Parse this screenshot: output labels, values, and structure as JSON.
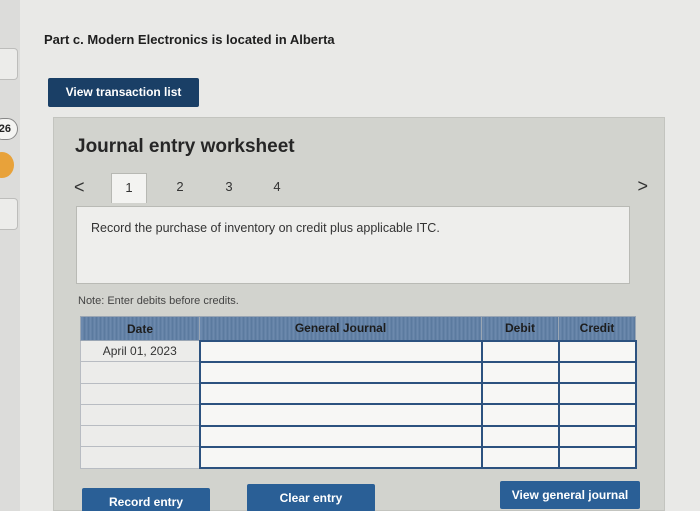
{
  "sidebar": {
    "question_number": "26"
  },
  "part_title": "Part c. Modern Electronics is located in Alberta",
  "view_transaction_button": "View transaction list",
  "worksheet": {
    "title": "Journal entry worksheet",
    "tabs": {
      "prev": "<",
      "items": [
        "1",
        "2",
        "3",
        "4"
      ],
      "active": "1",
      "next": ">"
    },
    "instruction": "Record the purchase of inventory on credit plus applicable ITC.",
    "note": "Note: Enter debits before credits.",
    "table": {
      "headers": {
        "date": "Date",
        "general_journal": "General Journal",
        "debit": "Debit",
        "credit": "Credit"
      },
      "rows": [
        {
          "date": "April 01, 2023",
          "account": "",
          "debit": "",
          "credit": ""
        },
        {
          "date": "",
          "account": "",
          "debit": "",
          "credit": ""
        },
        {
          "date": "",
          "account": "",
          "debit": "",
          "credit": ""
        },
        {
          "date": "",
          "account": "",
          "debit": "",
          "credit": ""
        },
        {
          "date": "",
          "account": "",
          "debit": "",
          "credit": ""
        },
        {
          "date": "",
          "account": "",
          "debit": "",
          "credit": ""
        }
      ]
    },
    "buttons": {
      "record": "Record entry",
      "clear": "Clear entry",
      "view_journal": "View general journal"
    }
  },
  "colors": {
    "primary_button": "#1a3f66",
    "action_button": "#2a5f96",
    "table_header": "#5f7fa6",
    "worksheet_bg": "#d2d3ce",
    "accent_dot": "#e8a23a"
  }
}
